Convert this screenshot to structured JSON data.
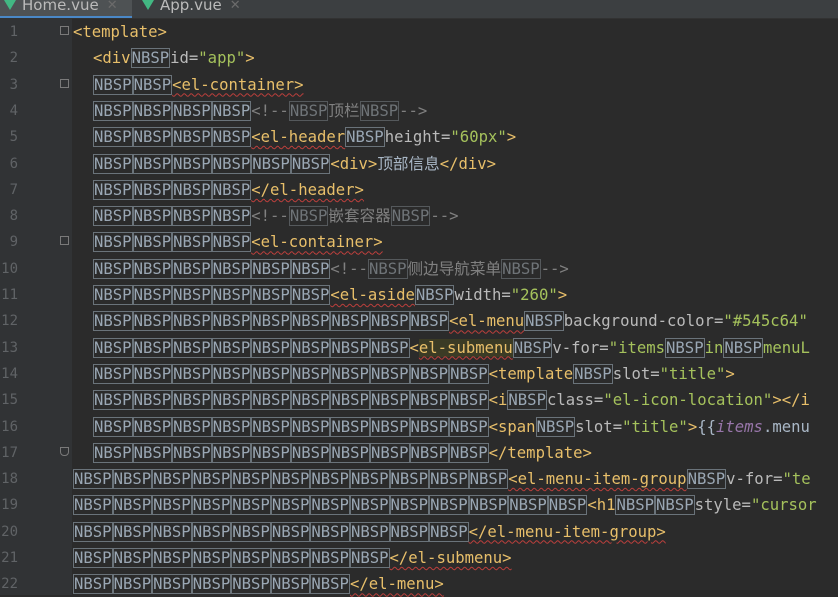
{
  "tabs": [
    {
      "label": "Home.vue",
      "active": true
    },
    {
      "label": "App.vue",
      "active": false
    }
  ],
  "nbsp_token": "NBSP",
  "lines": [
    {
      "n": "1",
      "fold": "start",
      "indent": 0,
      "parts": [
        {
          "t": "tag",
          "v": "<template>"
        }
      ]
    },
    {
      "n": "2",
      "indent": 1,
      "parts": [
        {
          "t": "tag",
          "v": "<div"
        },
        {
          "t": "nbsp",
          "c": 1
        },
        {
          "t": "attr",
          "v": "id="
        },
        {
          "t": "str",
          "v": "\"app\""
        },
        {
          "t": "tag",
          "v": ">"
        }
      ]
    },
    {
      "n": "3",
      "fold": "start",
      "indent": 1,
      "parts": [
        {
          "t": "nbsp",
          "c": 2
        },
        {
          "t": "tag",
          "v": "<el-container>",
          "sq": true
        }
      ]
    },
    {
      "n": "4",
      "indent": 1,
      "parts": [
        {
          "t": "nbsp",
          "c": 4
        },
        {
          "t": "com",
          "v": "<!--"
        },
        {
          "t": "nbspd",
          "c": 1
        },
        {
          "t": "com",
          "v": "顶栏"
        },
        {
          "t": "nbspd",
          "c": 1
        },
        {
          "t": "com",
          "v": "-->"
        }
      ]
    },
    {
      "n": "5",
      "indent": 1,
      "parts": [
        {
          "t": "nbsp",
          "c": 4
        },
        {
          "t": "tag",
          "v": "<el-header",
          "sq": true
        },
        {
          "t": "nbsp",
          "c": 1
        },
        {
          "t": "attr",
          "v": "height="
        },
        {
          "t": "str",
          "v": "\"60px\""
        },
        {
          "t": "tag",
          "v": ">"
        }
      ]
    },
    {
      "n": "6",
      "indent": 1,
      "parts": [
        {
          "t": "nbsp",
          "c": 6
        },
        {
          "t": "tag",
          "v": "<div>"
        },
        {
          "t": "txt",
          "v": "顶部信息"
        },
        {
          "t": "tag",
          "v": "</div>"
        }
      ]
    },
    {
      "n": "7",
      "indent": 1,
      "parts": [
        {
          "t": "nbsp",
          "c": 4
        },
        {
          "t": "tag",
          "v": "</el-header>",
          "sq": true
        }
      ]
    },
    {
      "n": "8",
      "indent": 1,
      "parts": [
        {
          "t": "nbsp",
          "c": 4
        },
        {
          "t": "com",
          "v": "<!--"
        },
        {
          "t": "nbspd",
          "c": 1
        },
        {
          "t": "com",
          "v": "嵌套容器"
        },
        {
          "t": "nbspd",
          "c": 1
        },
        {
          "t": "com",
          "v": "-->"
        }
      ]
    },
    {
      "n": "9",
      "fold": "start",
      "indent": 1,
      "parts": [
        {
          "t": "nbsp",
          "c": 4
        },
        {
          "t": "tag",
          "v": "<el-container>",
          "sq": true
        }
      ]
    },
    {
      "n": "10",
      "indent": 1,
      "parts": [
        {
          "t": "nbsp",
          "c": 6
        },
        {
          "t": "com",
          "v": "<!--"
        },
        {
          "t": "nbspd",
          "c": 1
        },
        {
          "t": "com",
          "v": "侧边导航菜单"
        },
        {
          "t": "nbspd",
          "c": 1
        },
        {
          "t": "com",
          "v": "-->"
        }
      ]
    },
    {
      "n": "11",
      "indent": 1,
      "parts": [
        {
          "t": "nbsp",
          "c": 6
        },
        {
          "t": "tag",
          "v": "<el-aside",
          "sq": true
        },
        {
          "t": "nbsp",
          "c": 1
        },
        {
          "t": "attr",
          "v": "width="
        },
        {
          "t": "str",
          "v": "\"260\""
        },
        {
          "t": "tag",
          "v": ">"
        }
      ]
    },
    {
      "n": "12",
      "indent": 1,
      "parts": [
        {
          "t": "nbsp",
          "c": 9
        },
        {
          "t": "tag",
          "v": "<el-menu",
          "sq": true
        },
        {
          "t": "nbsp",
          "c": 1
        },
        {
          "t": "attr",
          "v": "background-color="
        },
        {
          "t": "str",
          "v": "\"#545c64\""
        }
      ]
    },
    {
      "n": "13",
      "indent": 1,
      "parts": [
        {
          "t": "nbsp",
          "c": 8
        },
        {
          "t": "tag",
          "v": "<"
        },
        {
          "t": "tag",
          "v": "el-submenu",
          "sq": true,
          "hl": true
        },
        {
          "t": "nbsp",
          "c": 1
        },
        {
          "t": "attr",
          "v": "v-for="
        },
        {
          "t": "str",
          "v": "\"items"
        },
        {
          "t": "nbsp",
          "c": 1
        },
        {
          "t": "str",
          "v": "in"
        },
        {
          "t": "nbsp",
          "c": 1
        },
        {
          "t": "str",
          "v": "menuL"
        }
      ]
    },
    {
      "n": "14",
      "indent": 1,
      "parts": [
        {
          "t": "nbsp",
          "c": 10
        },
        {
          "t": "tag",
          "v": "<template"
        },
        {
          "t": "nbsp",
          "c": 1
        },
        {
          "t": "attr",
          "v": "slot="
        },
        {
          "t": "str",
          "v": "\"title\""
        },
        {
          "t": "tag",
          "v": ">"
        }
      ]
    },
    {
      "n": "15",
      "indent": 1,
      "parts": [
        {
          "t": "nbsp",
          "c": 10
        },
        {
          "t": "tag",
          "v": "<i"
        },
        {
          "t": "nbsp",
          "c": 1
        },
        {
          "t": "attr",
          "v": "class="
        },
        {
          "t": "str",
          "v": "\"el-icon-location\""
        },
        {
          "t": "tag",
          "v": "></i"
        }
      ]
    },
    {
      "n": "16",
      "indent": 1,
      "parts": [
        {
          "t": "nbsp",
          "c": 10
        },
        {
          "t": "tag",
          "v": "<span"
        },
        {
          "t": "nbsp",
          "c": 1
        },
        {
          "t": "attr",
          "v": "slot="
        },
        {
          "t": "str",
          "v": "\"title\""
        },
        {
          "t": "tag",
          "v": ">"
        },
        {
          "t": "txt",
          "v": "{{"
        },
        {
          "t": "var",
          "v": "items"
        },
        {
          "t": "txt",
          "v": ".menu"
        }
      ]
    },
    {
      "n": "17",
      "fold": "end",
      "indent": 1,
      "parts": [
        {
          "t": "nbsp",
          "c": 10
        },
        {
          "t": "tag",
          "v": "</template>"
        }
      ]
    },
    {
      "n": "18",
      "indent": 0,
      "parts": [
        {
          "t": "nbsp",
          "c": 11
        },
        {
          "t": "tag",
          "v": "<el-menu-item-group",
          "sq": true
        },
        {
          "t": "nbsp",
          "c": 1
        },
        {
          "t": "attr",
          "v": "v-for="
        },
        {
          "t": "str",
          "v": "\"te"
        }
      ]
    },
    {
      "n": "19",
      "indent": 0,
      "parts": [
        {
          "t": "nbsp",
          "c": 13
        },
        {
          "t": "tag",
          "v": "<h1"
        },
        {
          "t": "nbsp",
          "c": 2
        },
        {
          "t": "attr",
          "v": "style="
        },
        {
          "t": "str",
          "v": "\"cursor"
        }
      ]
    },
    {
      "n": "20",
      "indent": 0,
      "parts": [
        {
          "t": "nbsp",
          "c": 10
        },
        {
          "t": "tag",
          "v": "</el-menu-item-group>",
          "sq": true
        }
      ]
    },
    {
      "n": "21",
      "indent": 0,
      "parts": [
        {
          "t": "nbsp",
          "c": 8
        },
        {
          "t": "tag",
          "v": "</el-submenu>",
          "sq": true
        }
      ]
    },
    {
      "n": "22",
      "indent": 0,
      "parts": [
        {
          "t": "nbsp",
          "c": 7
        },
        {
          "t": "tag",
          "v": "</el-menu>",
          "sq": true
        }
      ]
    }
  ]
}
